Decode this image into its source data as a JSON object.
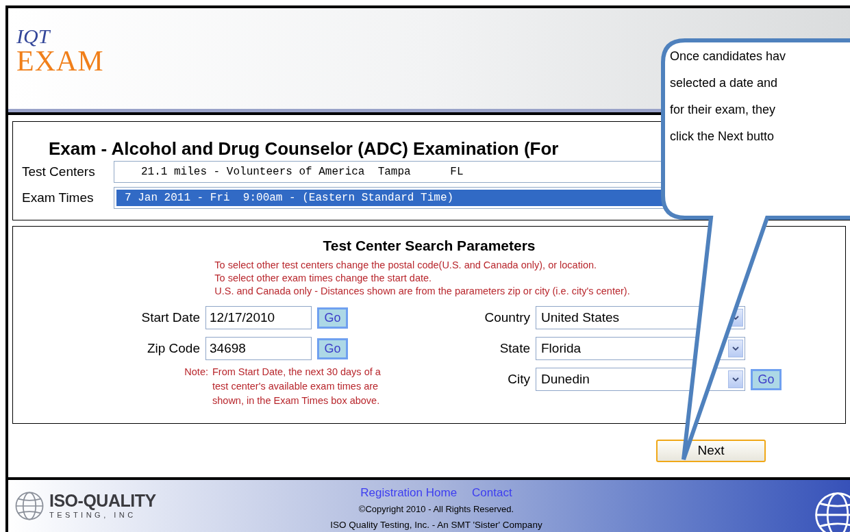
{
  "logo": {
    "top": "IQT",
    "bottom": "EXAM"
  },
  "exam": {
    "title": "Exam - Alcohol and Drug Counselor (ADC) Examination (For",
    "fields": [
      {
        "label": "Test Centers",
        "value": "21.1 miles - Volunteers of America  Tampa      FL",
        "selected": false
      },
      {
        "label": "Exam Times",
        "value": "7 Jan 2011 - Fri  9:00am - (Eastern Standard Time)",
        "selected": true
      }
    ]
  },
  "search": {
    "title": "Test Center Search Parameters",
    "instructions": [
      "To select other test centers change the postal code(U.S. and Canada only), or location.",
      "To select other exam times change the start date.",
      "U.S. and Canada only - Distances shown are from the parameters zip or city (i.e. city's center)."
    ],
    "left_fields": [
      {
        "label": "Start Date",
        "value": "12/17/2010",
        "button": "Go"
      },
      {
        "label": "Zip Code",
        "value": "34698",
        "button": "Go"
      }
    ],
    "note": {
      "label": "Note:",
      "lines": [
        "From Start Date, the next 30 days of a",
        "test center's available exam times are",
        "shown, in the Exam Times box above."
      ]
    },
    "right_fields": [
      {
        "label": "Country",
        "value": "United States"
      },
      {
        "label": "State",
        "value": "Florida"
      },
      {
        "label": "City",
        "value": "Dunedin",
        "button": "Go"
      }
    ]
  },
  "next_button": "Next",
  "footer": {
    "logo": {
      "name": "ISO-QUALITY",
      "sub": "TESTING, INC"
    },
    "links": [
      "Registration Home",
      "Contact"
    ],
    "copyright": "©Copyright 2010 - All Rights Reserved.",
    "company": "ISO Quality Testing, Inc. - An SMT 'Sister' Company"
  },
  "callout": {
    "lines": [
      "Once candidates hav",
      "selected a date and",
      "for their exam, they",
      "click the Next butto"
    ]
  }
}
